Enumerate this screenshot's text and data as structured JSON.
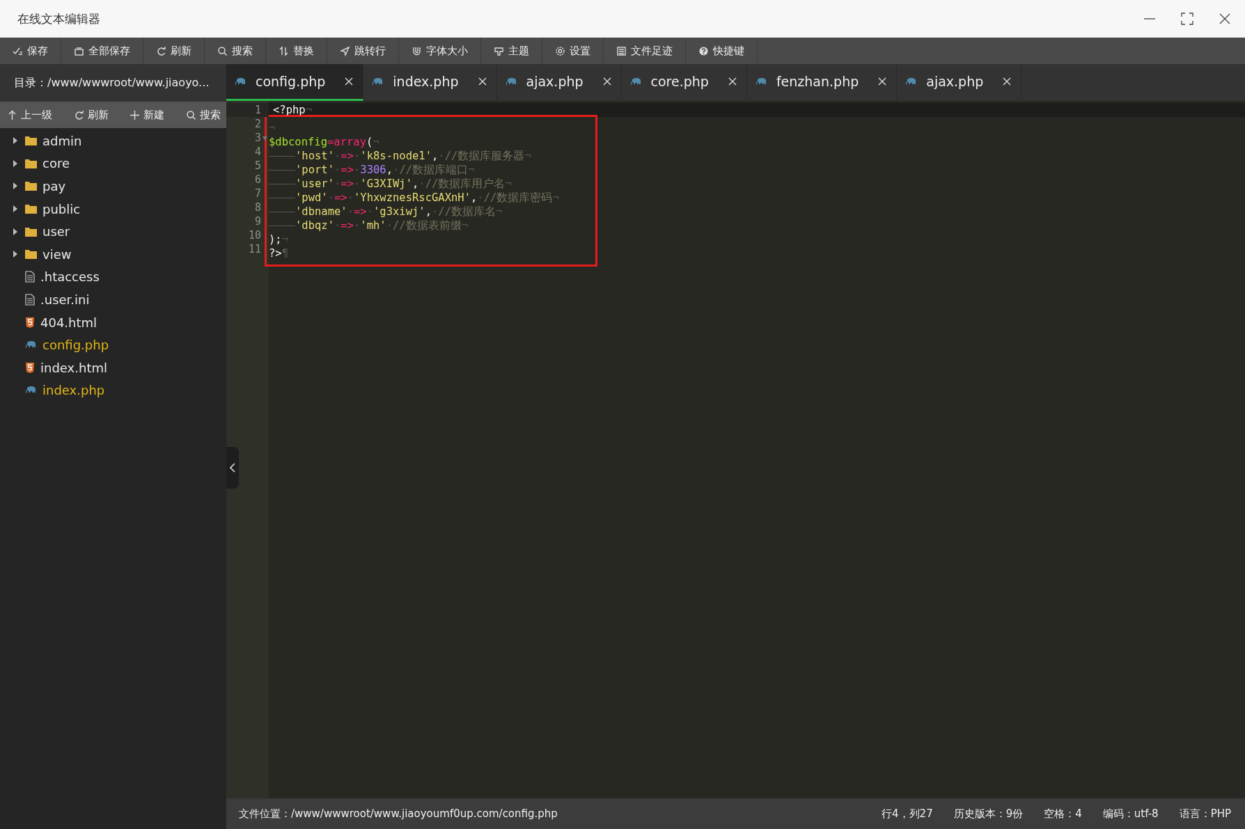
{
  "window": {
    "title": "在线文本编辑器"
  },
  "toolbar": [
    {
      "label": "保存"
    },
    {
      "label": "全部保存"
    },
    {
      "label": "刷新"
    },
    {
      "label": "搜索"
    },
    {
      "label": "替换"
    },
    {
      "label": "跳转行"
    },
    {
      "label": "字体大小"
    },
    {
      "label": "主题"
    },
    {
      "label": "设置"
    },
    {
      "label": "文件足迹"
    },
    {
      "label": "快捷键"
    }
  ],
  "sidebar": {
    "path": "目录：/www/wwwroot/www.jiaoyo...",
    "actions": [
      {
        "label": "上一级"
      },
      {
        "label": "刷新"
      },
      {
        "label": "新建"
      },
      {
        "label": "搜索"
      }
    ],
    "items": [
      {
        "kind": "folder",
        "name": "admin",
        "open": false
      },
      {
        "kind": "folder",
        "name": "core",
        "open": false
      },
      {
        "kind": "folder",
        "name": "pay",
        "open": false
      },
      {
        "kind": "folder",
        "name": "public",
        "open": false
      },
      {
        "kind": "folder",
        "name": "user",
        "open": false
      },
      {
        "kind": "folder",
        "name": "view",
        "open": false
      },
      {
        "kind": "file",
        "name": ".htaccess",
        "opened": false
      },
      {
        "kind": "file",
        "name": ".user.ini",
        "opened": false
      },
      {
        "kind": "html",
        "name": "404.html",
        "opened": false
      },
      {
        "kind": "php",
        "name": "config.php",
        "opened": true
      },
      {
        "kind": "html",
        "name": "index.html",
        "opened": false
      },
      {
        "kind": "php",
        "name": "index.php",
        "opened": true
      }
    ]
  },
  "tabs": [
    {
      "label": "config.php",
      "selected": true
    },
    {
      "label": "index.php",
      "selected": false
    },
    {
      "label": "ajax.php",
      "selected": false
    },
    {
      "label": "core.php",
      "selected": false
    },
    {
      "label": "fenzhan.php",
      "selected": false
    },
    {
      "label": "ajax.php",
      "selected": false
    }
  ],
  "editor": {
    "lines": [
      {
        "number": "1",
        "current": true,
        "fold": false,
        "boxed": false,
        "tokens": [
          {
            "kind": "plain",
            "text": "<?php"
          },
          {
            "kind": "ws",
            "text": "¬"
          }
        ]
      },
      {
        "number": "2",
        "current": false,
        "fold": false,
        "boxed": true,
        "tokens": [
          {
            "kind": "ws",
            "text": "¬"
          }
        ]
      },
      {
        "number": "3",
        "current": false,
        "fold": true,
        "boxed": true,
        "tokens": [
          {
            "kind": "var",
            "text": "$dbconfig"
          },
          {
            "kind": "op",
            "text": "="
          },
          {
            "kind": "kw",
            "text": "array"
          },
          {
            "kind": "plain",
            "text": "("
          },
          {
            "kind": "ws",
            "text": "¬"
          }
        ]
      },
      {
        "number": "4",
        "current": false,
        "fold": false,
        "boxed": true,
        "tokens": [
          {
            "kind": "tab"
          },
          {
            "kind": "str",
            "text": "'host'"
          },
          {
            "kind": "ws",
            "text": "·"
          },
          {
            "kind": "op",
            "text": "=>"
          },
          {
            "kind": "ws",
            "text": "·"
          },
          {
            "kind": "str",
            "text": "'k8s-node1'"
          },
          {
            "kind": "plain",
            "text": ","
          },
          {
            "kind": "ws",
            "text": "·"
          },
          {
            "kind": "cmt",
            "text": "//数据库服务器"
          },
          {
            "kind": "ws",
            "text": "¬"
          }
        ]
      },
      {
        "number": "5",
        "current": false,
        "fold": false,
        "boxed": true,
        "tokens": [
          {
            "kind": "tab"
          },
          {
            "kind": "str",
            "text": "'port'"
          },
          {
            "kind": "ws",
            "text": "·"
          },
          {
            "kind": "op",
            "text": "=>"
          },
          {
            "kind": "ws",
            "text": "·"
          },
          {
            "kind": "num",
            "text": "3306"
          },
          {
            "kind": "plain",
            "text": ","
          },
          {
            "kind": "ws",
            "text": "·"
          },
          {
            "kind": "cmt",
            "text": "//数据库端口"
          },
          {
            "kind": "ws",
            "text": "¬"
          }
        ]
      },
      {
        "number": "6",
        "current": false,
        "fold": false,
        "boxed": true,
        "tokens": [
          {
            "kind": "tab"
          },
          {
            "kind": "str",
            "text": "'user'"
          },
          {
            "kind": "ws",
            "text": "·"
          },
          {
            "kind": "op",
            "text": "=>"
          },
          {
            "kind": "ws",
            "text": "·"
          },
          {
            "kind": "str",
            "text": "'G3XIWj'"
          },
          {
            "kind": "plain",
            "text": ","
          },
          {
            "kind": "ws",
            "text": "·"
          },
          {
            "kind": "cmt",
            "text": "//数据库用户名"
          },
          {
            "kind": "ws",
            "text": "¬"
          }
        ]
      },
      {
        "number": "7",
        "current": false,
        "fold": false,
        "boxed": true,
        "tokens": [
          {
            "kind": "tab"
          },
          {
            "kind": "str",
            "text": "'pwd'"
          },
          {
            "kind": "ws",
            "text": "·"
          },
          {
            "kind": "op",
            "text": "=>"
          },
          {
            "kind": "ws",
            "text": "·"
          },
          {
            "kind": "str",
            "text": "'YhxwznesRscGAXnH'"
          },
          {
            "kind": "plain",
            "text": ","
          },
          {
            "kind": "ws",
            "text": "·"
          },
          {
            "kind": "cmt",
            "text": "//数据库密码"
          },
          {
            "kind": "ws",
            "text": "¬"
          }
        ]
      },
      {
        "number": "8",
        "current": false,
        "fold": false,
        "boxed": true,
        "tokens": [
          {
            "kind": "tab"
          },
          {
            "kind": "str",
            "text": "'dbname'"
          },
          {
            "kind": "ws",
            "text": "·"
          },
          {
            "kind": "op",
            "text": "=>"
          },
          {
            "kind": "ws",
            "text": "·"
          },
          {
            "kind": "str",
            "text": "'g3xiwj'"
          },
          {
            "kind": "plain",
            "text": ","
          },
          {
            "kind": "ws",
            "text": "·"
          },
          {
            "kind": "cmt",
            "text": "//数据库名"
          },
          {
            "kind": "ws",
            "text": "¬"
          }
        ]
      },
      {
        "number": "9",
        "current": false,
        "fold": false,
        "boxed": true,
        "tokens": [
          {
            "kind": "tab"
          },
          {
            "kind": "str",
            "text": "'dbqz'"
          },
          {
            "kind": "ws",
            "text": "·"
          },
          {
            "kind": "op",
            "text": "=>"
          },
          {
            "kind": "ws",
            "text": "·"
          },
          {
            "kind": "str",
            "text": "'mh'"
          },
          {
            "kind": "ws",
            "text": "·"
          },
          {
            "kind": "cmt",
            "text": "//数据表前缀"
          },
          {
            "kind": "ws",
            "text": "¬"
          }
        ]
      },
      {
        "number": "10",
        "current": false,
        "fold": false,
        "boxed": true,
        "tokens": [
          {
            "kind": "plain",
            "text": ");"
          },
          {
            "kind": "ws",
            "text": "¬"
          }
        ]
      },
      {
        "number": "11",
        "current": false,
        "fold": false,
        "boxed": true,
        "tokens": [
          {
            "kind": "plain",
            "text": "?>"
          },
          {
            "kind": "ws",
            "text": "¶"
          }
        ]
      }
    ]
  },
  "status_bar": {
    "file": "文件位置：/www/wwwroot/www.jiaoyoumf0up.com/config.php",
    "items": [
      "行4，列27",
      "历史版本：9份",
      "空格：4",
      "编码：utf-8",
      "语言：PHP"
    ]
  }
}
